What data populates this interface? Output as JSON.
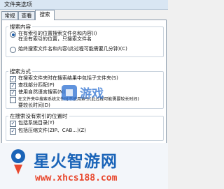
{
  "window": {
    "title": "文件夹选项"
  },
  "tabs": [
    {
      "label": "常规",
      "active": false
    },
    {
      "label": "查看",
      "active": false
    },
    {
      "label": "搜索",
      "active": true
    }
  ],
  "content_group": {
    "title": "搜索内容",
    "options": [
      {
        "line1": "在有索引的位置搜索文件名和内容(I)",
        "line2": "在没有索引的位置，只搜索文件名",
        "selected": true
      },
      {
        "line1": "始终搜索文件名和内容(此过程可能需要几分钟)(C)",
        "line2": "",
        "selected": false
      }
    ]
  },
  "method_group": {
    "title": "搜索方式",
    "options": [
      {
        "line1": "在搜索文件夹时在搜索结果中包括子文件夹(S)",
        "line2": "",
        "checked": true
      },
      {
        "line1": "查找部分匹配(P)",
        "line2": "",
        "checked": true
      },
      {
        "line1": "使用自然语言搜索(N)",
        "line2": "",
        "checked": true
      },
      {
        "line1": "在文件夹中搜索系统文件时不使用索引(此过程可能需要较长时间)",
        "line2": "要较长时间(D)",
        "checked": false
      }
    ]
  },
  "nonindexed_group": {
    "title": "在搜索没有索引的位置时",
    "options": [
      {
        "line1": "包括系统目录(Y)",
        "checked": true
      },
      {
        "line1": "包括压缩文件(ZIP、CAB...)(Z)",
        "checked": true
      }
    ]
  },
  "overlay_logo": {
    "text": "游戏"
  },
  "watermark": {
    "title": "星火智游网",
    "url": "www.xhcs188.com"
  },
  "colors": {
    "brand_blue": "#1a64b8",
    "url_red": "#e8482e"
  }
}
